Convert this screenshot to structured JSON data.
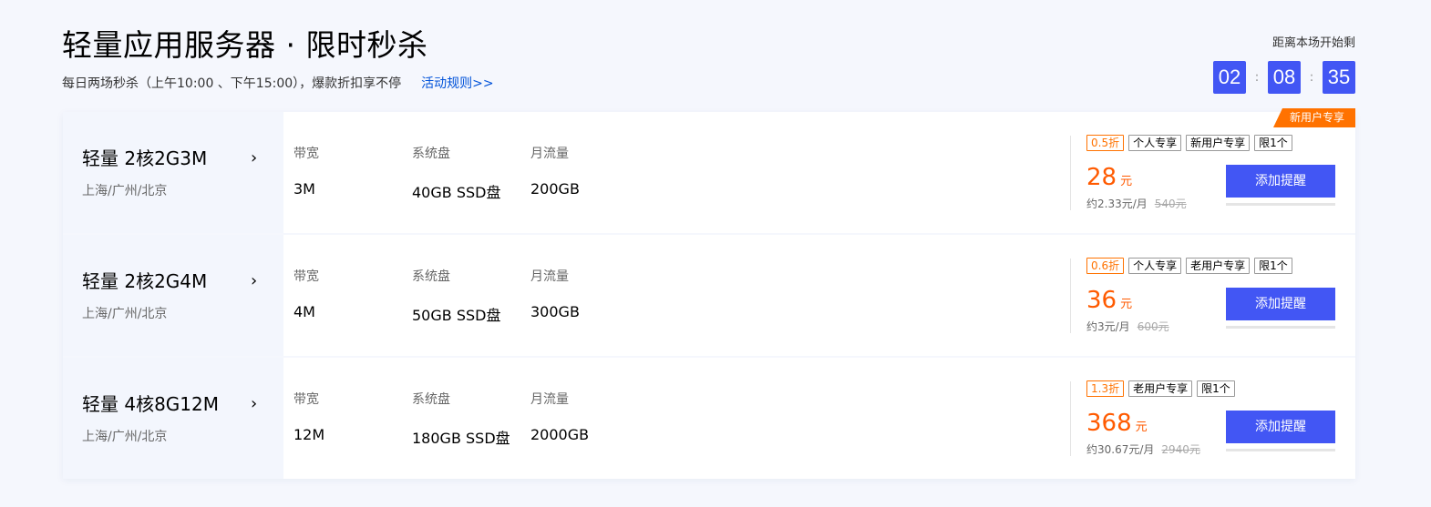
{
  "header": {
    "title": "轻量应用服务器 · 限时秒杀",
    "subtitle": "每日两场秒杀（上午10:00 、下午15:00），爆款折扣享不停",
    "rules_link": "活动规则>>"
  },
  "countdown": {
    "label": "距离本场开始剩",
    "hours": "02",
    "minutes": "08",
    "seconds": "35",
    "separator": ":"
  },
  "colors": {
    "accent": "#4256f4",
    "price": "#ff5a00",
    "badge": "#ff7200"
  },
  "spec_labels": {
    "bandwidth": "带宽",
    "disk": "系统盘",
    "traffic": "月流量"
  },
  "button_label": "添加提醒",
  "icons": {
    "arrow": "chevron-right-icon"
  },
  "products": [
    {
      "name": "轻量 2核2G3M",
      "arrow": "›",
      "region": "上海/广州/北京",
      "bandwidth": "3M",
      "disk": "40GB SSD盘",
      "traffic": "200GB",
      "discount": "0.5折",
      "tags": [
        "个人专享",
        "新用户专享",
        "限1个"
      ],
      "price": "28",
      "unit": "元",
      "monthly": "约2.33元/月",
      "original": "540元",
      "corner_badge": "新用户专享"
    },
    {
      "name": "轻量 2核2G4M",
      "arrow": "›",
      "region": "上海/广州/北京",
      "bandwidth": "4M",
      "disk": "50GB SSD盘",
      "traffic": "300GB",
      "discount": "0.6折",
      "tags": [
        "个人专享",
        "老用户专享",
        "限1个"
      ],
      "price": "36",
      "unit": "元",
      "monthly": "约3元/月",
      "original": "600元"
    },
    {
      "name": "轻量 4核8G12M",
      "arrow": "›",
      "region": "上海/广州/北京",
      "bandwidth": "12M",
      "disk": "180GB SSD盘",
      "traffic": "2000GB",
      "discount": "1.3折",
      "tags": [
        "老用户专享",
        "限1个"
      ],
      "price": "368",
      "unit": "元",
      "monthly": "约30.67元/月",
      "original": "2940元"
    }
  ]
}
